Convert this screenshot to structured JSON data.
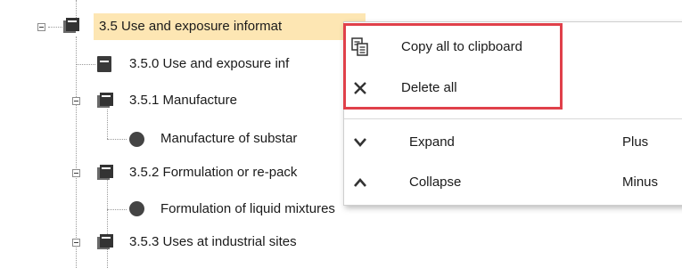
{
  "tree": {
    "items": [
      {
        "label": "3.5 Use and exposure informat",
        "icon": "section-folder-icon",
        "highlighted": true
      },
      {
        "label": "3.5.0 Use and exposure inf",
        "icon": "document-icon"
      },
      {
        "label": "3.5.1 Manufacture",
        "icon": "section-folder-icon"
      },
      {
        "label": "Manufacture of substar",
        "icon": "record-dot-icon"
      },
      {
        "label": "3.5.2 Formulation or re-pack",
        "icon": "section-folder-icon"
      },
      {
        "label": "Formulation of liquid mixtures",
        "icon": "record-dot-icon"
      },
      {
        "label": "3.5.3 Uses at industrial sites",
        "icon": "section-folder-icon"
      }
    ]
  },
  "context_menu": {
    "items": [
      {
        "label": "Copy all to clipboard",
        "icon": "copy-clipboard-icon",
        "shortcut": ""
      },
      {
        "label": "Delete all",
        "icon": "close-x-icon",
        "shortcut": ""
      },
      {
        "label": "Expand",
        "icon": "chevron-down-icon",
        "shortcut": "Plus"
      },
      {
        "label": "Collapse",
        "icon": "chevron-up-icon",
        "shortcut": "Minus"
      }
    ]
  },
  "colors": {
    "selection_highlight": "#fde6b3",
    "annotation_box": "#e0404a"
  }
}
